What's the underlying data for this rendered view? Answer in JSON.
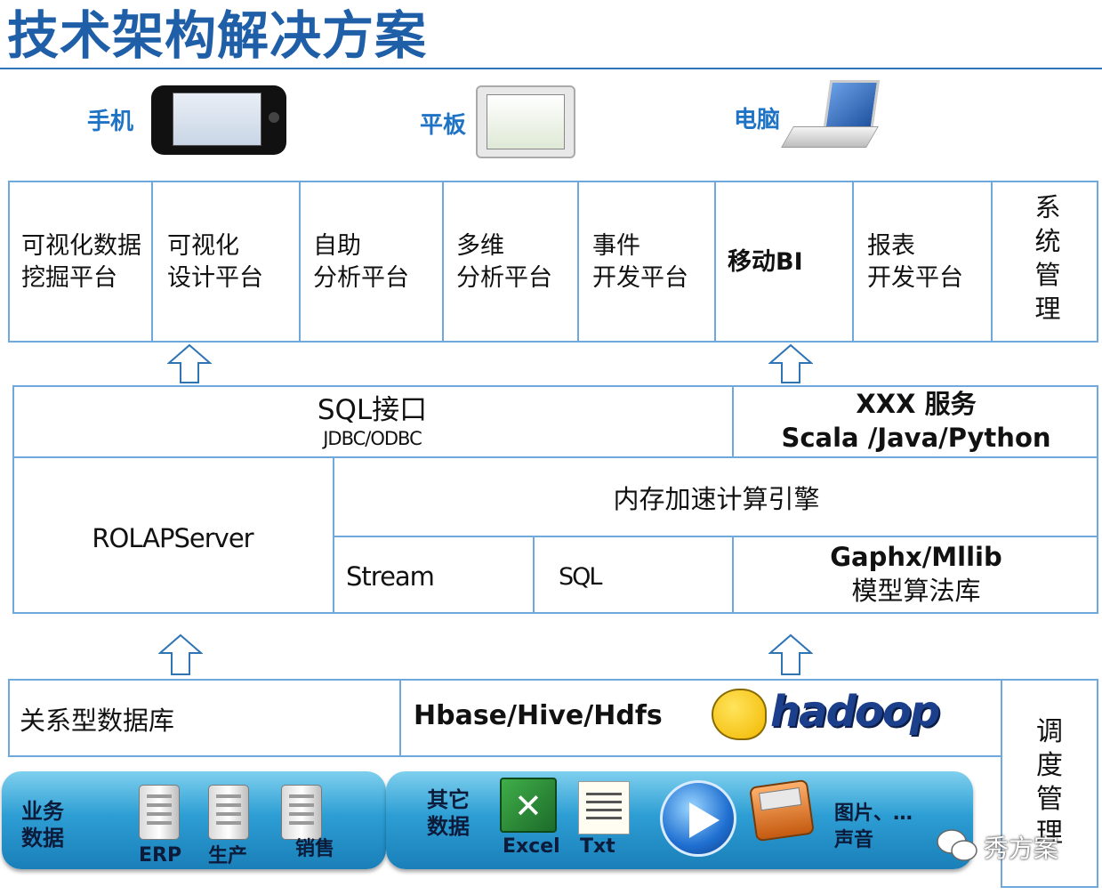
{
  "title": "技术架构解决方案",
  "devices": [
    {
      "label": "手机",
      "icon": "phone-icon"
    },
    {
      "label": "平板",
      "icon": "tablet-icon"
    },
    {
      "label": "电脑",
      "icon": "laptop-icon"
    }
  ],
  "apps": [
    {
      "line1": "可视化数据",
      "line2": "挖掘平台"
    },
    {
      "line1": "可视化",
      "line2": "设计平台"
    },
    {
      "line1": "自助",
      "line2": "分析平台"
    },
    {
      "line1": "多维",
      "line2": "分析平台"
    },
    {
      "line1": "事件",
      "line2": "开发平台"
    },
    {
      "line1": "移动BI",
      "line2": ""
    },
    {
      "line1": "报表",
      "line2": "开发平台"
    }
  ],
  "system_mgmt": [
    "系",
    "统",
    "管",
    "理"
  ],
  "interface": {
    "sql_label": "SQL接口",
    "sql_sub": "JDBC/ODBC",
    "service_label": "XXX 服务",
    "service_langs": "Scala /Java/Python"
  },
  "engine": {
    "rolap": "ROLAPServer",
    "memory_engine": "内存加速计算引擎",
    "stream": "Stream",
    "sql": "SQL",
    "ml_line1": "Gaphx/Mllib",
    "ml_line2": "模型算法库"
  },
  "storage": {
    "relational": "关系型数据库",
    "hadoop_stack": "Hbase/Hive/Hdfs",
    "hadoop_logo": "hadoop"
  },
  "schedule_mgmt": [
    "调",
    "度",
    "管",
    "理"
  ],
  "sources": {
    "business_line1": "业务",
    "business_line2": "数据",
    "erp": "ERP",
    "production": "生产",
    "sales": "销售",
    "other_line1": "其它",
    "other_line2": "数据",
    "excel": "Excel",
    "txt": "Txt",
    "media_line1": "图片、…",
    "media_line2": "声音"
  },
  "watermark": "秀方案",
  "colors": {
    "title": "#1f5fa8",
    "border": "#6fa8dc",
    "bar": "#2d9ed4",
    "label": "#1f73c4"
  }
}
